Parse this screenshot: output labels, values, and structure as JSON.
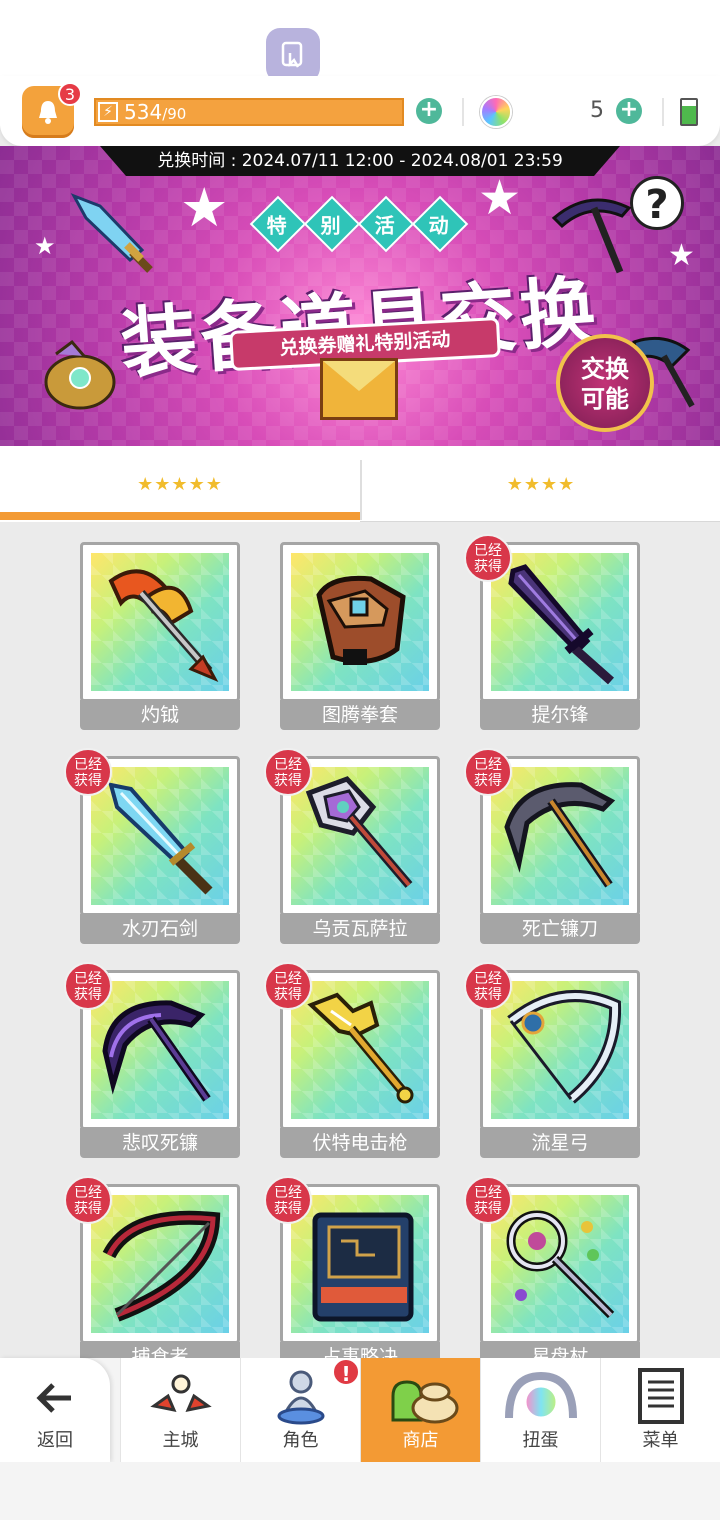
{
  "header": {
    "notification_count": "3",
    "energy_current": "534",
    "energy_max": "/90",
    "gem_count": "5"
  },
  "banner": {
    "exchange_time": "兑换时间 : 2024.07/11 12:00 - 2024.08/01 23:59",
    "special_tag": [
      "特",
      "别",
      "活",
      "动"
    ],
    "title": "装备道具交换",
    "ribbon": "兑换券赠礼特别活动",
    "exchange_badge_line1": "交换",
    "exchange_badge_line2": "可能",
    "help": "?"
  },
  "tabs": [
    {
      "label": "★★★★★",
      "active": true
    },
    {
      "label": "★★★★",
      "active": false
    }
  ],
  "owned_label_line1": "已经",
  "owned_label_line2": "获得",
  "items": [
    {
      "name": "灼钺",
      "owned": false,
      "icon": "axe-icon"
    },
    {
      "name": "图腾拳套",
      "owned": false,
      "icon": "gauntlet-icon"
    },
    {
      "name": "提尔锋",
      "owned": true,
      "icon": "dark-sword-icon"
    },
    {
      "name": "水刃石剑",
      "owned": true,
      "icon": "water-blade-icon"
    },
    {
      "name": "乌贡瓦萨拉",
      "owned": true,
      "icon": "battle-axe-icon"
    },
    {
      "name": "死亡镰刀",
      "owned": true,
      "icon": "death-scythe-icon"
    },
    {
      "name": "悲叹死镰",
      "owned": true,
      "icon": "lament-scythe-icon"
    },
    {
      "name": "伏特电击枪",
      "owned": true,
      "icon": "volt-gun-icon"
    },
    {
      "name": "流星弓",
      "owned": true,
      "icon": "meteor-bow-icon"
    },
    {
      "name": "捕食者",
      "owned": true,
      "icon": "predator-bow-icon"
    },
    {
      "name": "占事略决",
      "owned": true,
      "icon": "tome-icon"
    },
    {
      "name": "星盘杖",
      "owned": true,
      "icon": "astrolabe-staff-icon"
    }
  ],
  "nav": {
    "back": "返回",
    "main": "主城",
    "character": "角色",
    "shop": "商店",
    "gacha": "扭蛋",
    "menu": "菜单",
    "character_alert": "!"
  },
  "colors": {
    "accent": "#f39a34",
    "owned_badge": "#d8374a",
    "plus_button": "#4fb89a",
    "banner_pink": "#d84db8"
  }
}
